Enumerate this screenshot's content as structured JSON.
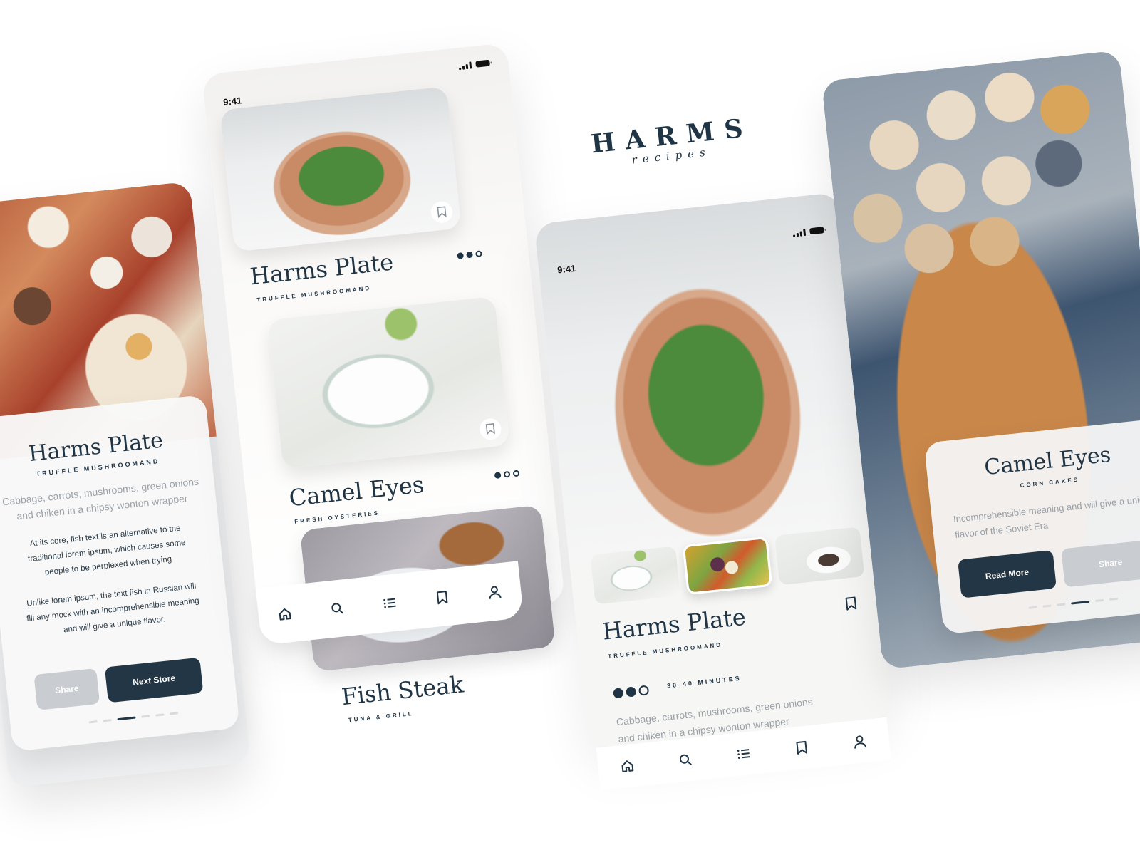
{
  "brand": {
    "name": "HARMS",
    "tagline": "recipes"
  },
  "status_bar": {
    "time": "9:41",
    "signal_icon": "cellular-signal-icon",
    "battery_icon": "battery-icon"
  },
  "screen_intro": {
    "title": "Harms Plate",
    "subtitle": "Truffle Mushroomand",
    "lead": "Cabbage, carrots, mushrooms, green onions and chiken in a chipsy wonton wrapper",
    "body_p1": "At its core, fish text is an alternative to the traditional lorem ipsum, which causes some people to be perplexed when trying",
    "body_p2": "Unlike lorem ipsum, the text fish in Russian will fill any mock with an incomprehensible meaning and will give a unique flavor.",
    "share_label": "Share",
    "next_label": "Next Store",
    "pager": {
      "total": 6,
      "active": 3
    }
  },
  "screen_list": {
    "items": [
      {
        "title": "Harms Plate",
        "subtitle": "Truffle Mushroomand",
        "rating_filled": 2,
        "rating_total": 3,
        "bookmark_icon": "bookmark-icon"
      },
      {
        "title": "Camel Eyes",
        "subtitle": "Fresh Oysteries",
        "rating_filled": 1,
        "rating_total": 3,
        "bookmark_icon": "bookmark-icon"
      },
      {
        "title": "Fish Steak",
        "subtitle": "Tuna & Grill"
      }
    ],
    "tabbar": [
      "home-icon",
      "search-icon",
      "list-icon",
      "bookmark-icon",
      "user-icon"
    ]
  },
  "screen_detail": {
    "title": "Harms Plate",
    "subtitle": "Truffle Mushroomand",
    "rating_filled": 2,
    "rating_total": 3,
    "duration": "30-40 Minutes",
    "description": "Cabbage, carrots, mushrooms, green onions and chiken in a chipsy wonton wrapper",
    "thumbnails": 3,
    "selected_thumbnail": 2,
    "tabbar": [
      "home-icon",
      "search-icon",
      "list-icon",
      "bookmark-icon",
      "user-icon"
    ]
  },
  "screen_featured": {
    "title": "Camel Eyes",
    "subtitle": "Corn Cakes",
    "lead": "Incomprehensible meaning and will give a unique flavor of the Soviet Era",
    "read_more_label": "Read More",
    "share_label": "Share",
    "pager": {
      "total": 6,
      "active": 4
    }
  },
  "colors": {
    "primary_dark": "#223645",
    "text_dark": "#1f3444",
    "muted": "#9aa0a6",
    "button_gray": "#c9ccd0",
    "background": "#ffffff"
  }
}
